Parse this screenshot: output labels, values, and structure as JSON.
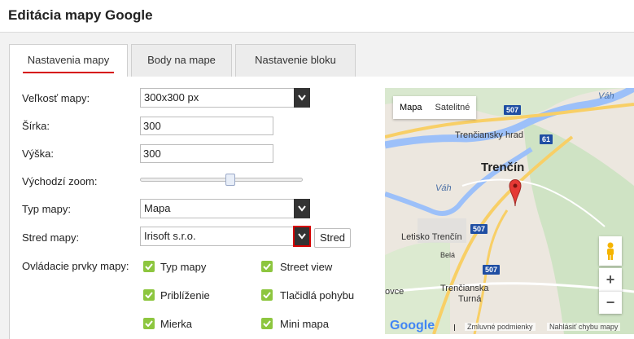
{
  "header": {
    "title": "Editácia mapy Google"
  },
  "tabs": [
    {
      "label": "Nastavenia mapy",
      "active": true
    },
    {
      "label": "Body na mape",
      "active": false
    },
    {
      "label": "Nastavenie bloku",
      "active": false
    }
  ],
  "form": {
    "size_label": "Veľkosť mapy:",
    "size_value": "300x300 px",
    "width_label": "Šírka:",
    "width_value": "300",
    "height_label": "Výška:",
    "height_value": "300",
    "zoom_label": "Východzí zoom:",
    "zoom_level": 0.56,
    "type_label": "Typ mapy:",
    "type_value": "Mapa",
    "center_label": "Stred mapy:",
    "center_value": "Irisoft s.r.o.",
    "center_button": "Stred",
    "controls_label": "Ovládacie prvky mapy:",
    "controls": [
      {
        "label": "Typ mapy",
        "checked": true
      },
      {
        "label": "Street view",
        "checked": true
      },
      {
        "label": "Priblíženie",
        "checked": true
      },
      {
        "label": "Tlačidlá pohybu",
        "checked": true
      },
      {
        "label": "Mierka",
        "checked": true
      },
      {
        "label": "Mini mapa",
        "checked": true
      }
    ]
  },
  "map": {
    "type_buttons": [
      "Mapa",
      "Satelitné"
    ],
    "city": "Trenčín",
    "castle": "Trenčiansky hrad",
    "airport": "Letisko Trenčín",
    "district": "Trenčianska",
    "district2": "Turná",
    "river1": "Váh",
    "river2": "Váh",
    "road_belá": "Belá",
    "place_left": "ovce",
    "shields": [
      "507",
      "61",
      "507",
      "507"
    ],
    "zoom_in": "+",
    "zoom_out": "−",
    "footer_terms": "Zmluvné podmienky",
    "footer_report": "Nahlásiť chybu mapy",
    "logo": "Google"
  },
  "colors": {
    "accent": "#d60000",
    "check": "#8dc63f",
    "river": "#9cc0f9",
    "road": "#f8cf66",
    "marker": "#e53935"
  }
}
